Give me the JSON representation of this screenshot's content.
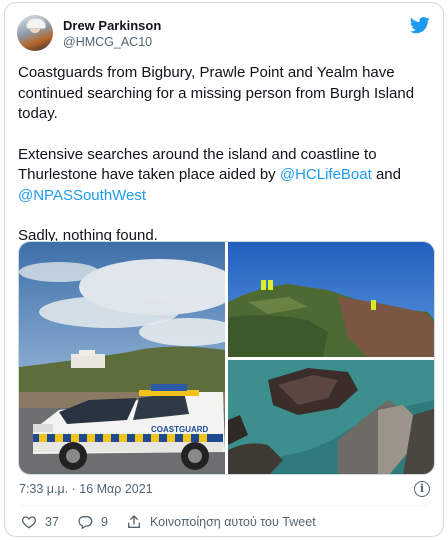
{
  "author": {
    "name": "Drew Parkinson",
    "handle": "@HMCG_AC10"
  },
  "tweet": {
    "paragraph1": "Coastguards from Bigbury, Prawle Point and Yealm have continued searching for a missing person from Burgh Island today.",
    "paragraph2_prefix": "Extensive searches around the island and coastline to Thurlestone have taken place aided by ",
    "mention1": "@HCLifeBoat",
    "paragraph2_joiner": " and",
    "mention2": "@NPASSouthWest",
    "paragraph3": "Sadly, nothing found."
  },
  "photos": {
    "photo1": {
      "vehicle_text": "COASTGUARD"
    }
  },
  "meta": {
    "timestamp": "7:33 μ.μ. · 16 Μαρ 2021"
  },
  "actions": {
    "like_count": "37",
    "reply_count": "9",
    "share_label": "Κοινοποίηση αυτού του Tweet"
  },
  "colors": {
    "accent": "#1d9bf0",
    "muted": "#536471",
    "border": "#cfd9de"
  },
  "icons": {
    "brand": "twitter-bird-icon",
    "info": "info-icon",
    "like": "heart-icon",
    "reply": "reply-icon",
    "share": "share-icon"
  }
}
